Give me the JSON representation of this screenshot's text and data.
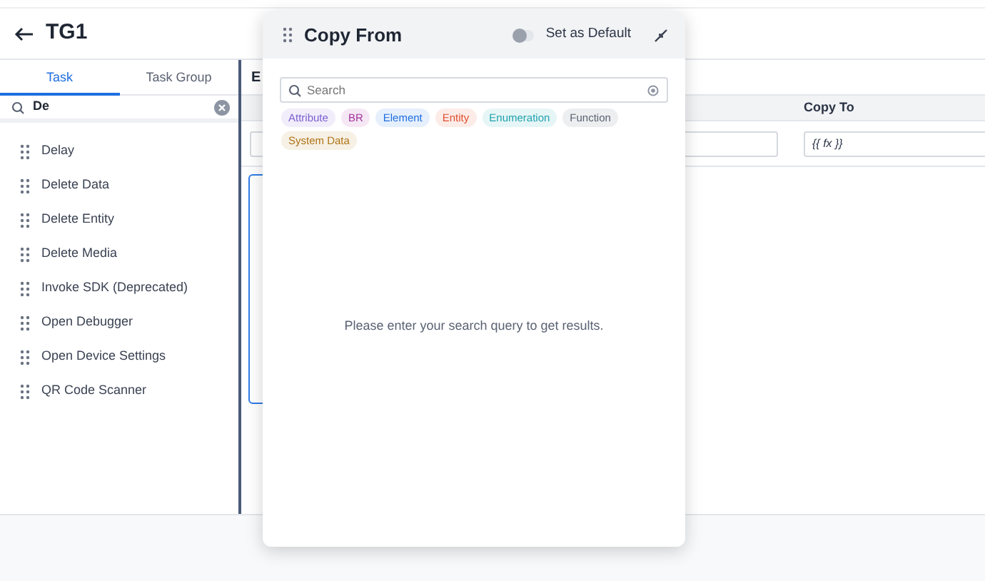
{
  "page": {
    "title": "TG1"
  },
  "sidebar": {
    "tabs": [
      {
        "label": "Task",
        "selected": true
      },
      {
        "label": "Task Group",
        "selected": false
      }
    ],
    "search": {
      "value": "De"
    },
    "items": [
      "Delay",
      "Delete Data",
      "Delete Entity",
      "Delete Media",
      "Invoke SDK (Deprecated)",
      "Open Debugger",
      "Open Device Settings",
      "QR Code Scanner"
    ]
  },
  "main": {
    "tabs": [
      {
        "label": "E",
        "selected": true
      }
    ],
    "column": "Copy To",
    "copy_to_value": "{{ fx }}"
  },
  "popup": {
    "title": "Copy From",
    "set_default": {
      "label": "Set as Default",
      "on": false
    },
    "search": {
      "placeholder": "Search"
    },
    "filters": [
      {
        "label": "Attribute",
        "color": "#7b5fd1"
      },
      {
        "label": "BR",
        "color": "#a3329e"
      },
      {
        "label": "Element",
        "color": "#1f6fe0"
      },
      {
        "label": "Entity",
        "color": "#e0502f"
      },
      {
        "label": "Enumeration",
        "color": "#1fa3ad"
      },
      {
        "label": "Function",
        "color": "#5a6272"
      },
      {
        "label": "System Data",
        "color": "#b07415"
      }
    ],
    "empty_message": "Please enter your search query to get results."
  }
}
